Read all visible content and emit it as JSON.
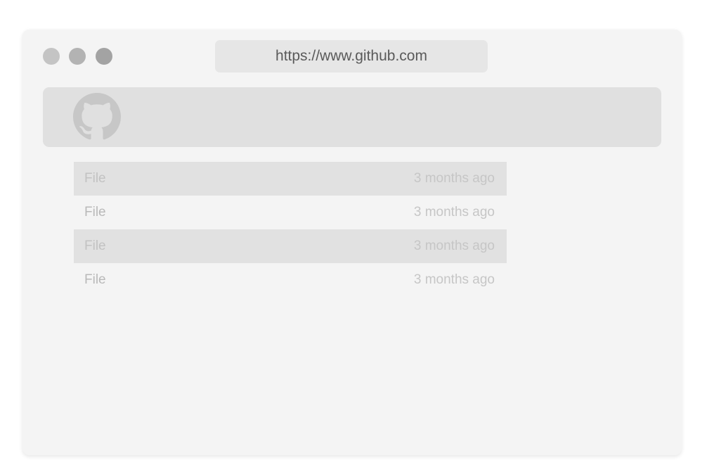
{
  "browser": {
    "url": "https://www.github.com",
    "logo_icon": "github-octocat-icon"
  },
  "files": [
    {
      "name": "File",
      "modified": "3 months ago"
    },
    {
      "name": "File",
      "modified": "3 months ago"
    },
    {
      "name": "File",
      "modified": "3 months ago"
    },
    {
      "name": "File",
      "modified": "3 months ago"
    }
  ]
}
